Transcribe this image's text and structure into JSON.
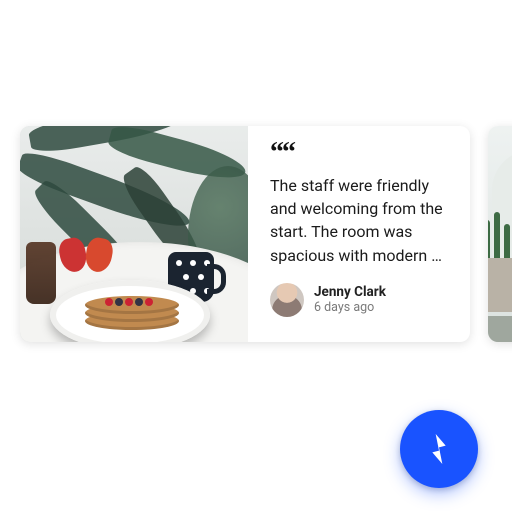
{
  "reviews": [
    {
      "quote_glyph": "““",
      "text": "The staff were friendly and welcoming from the start. The room was spacious with modern …",
      "author_name": "Jenny Clark",
      "author_time": "6 days ago"
    }
  ],
  "colors": {
    "fab": "#1953ff"
  }
}
